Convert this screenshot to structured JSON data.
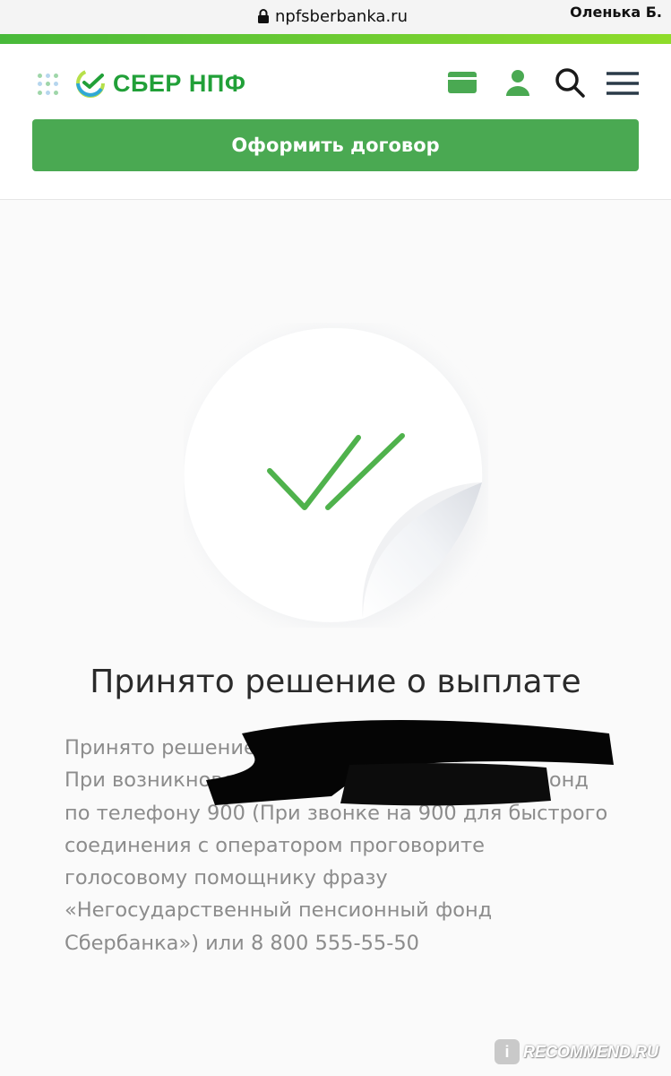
{
  "browser": {
    "url": "npfsberbanka.ru",
    "user_name": "Оленька Б."
  },
  "header": {
    "logo_text": "СБЕР НПФ",
    "cta_label": "Оформить договор",
    "icons": [
      "apps-grid-icon",
      "card-icon",
      "profile-icon",
      "search-icon",
      "menu-icon"
    ]
  },
  "main": {
    "title": "Принято решение о выплате",
    "paragraph": "Принято решение о выплате ... перечисления ... При возникновении вопросов обратитесь в Фонд по телефону 900 (При звонке на 900 для быстрого соединения с оператором проговорите голосовому помощнику фразу «Негосударственный пенсионный фонд Сбербанка») или 8 800 555-55-50"
  },
  "watermark": {
    "text": "RECOMMEND.RU"
  },
  "colors": {
    "brand_green": "#21a038",
    "button_green": "#4aa952",
    "check_green": "#4fb24c",
    "muted_text": "#8c8c8c"
  }
}
